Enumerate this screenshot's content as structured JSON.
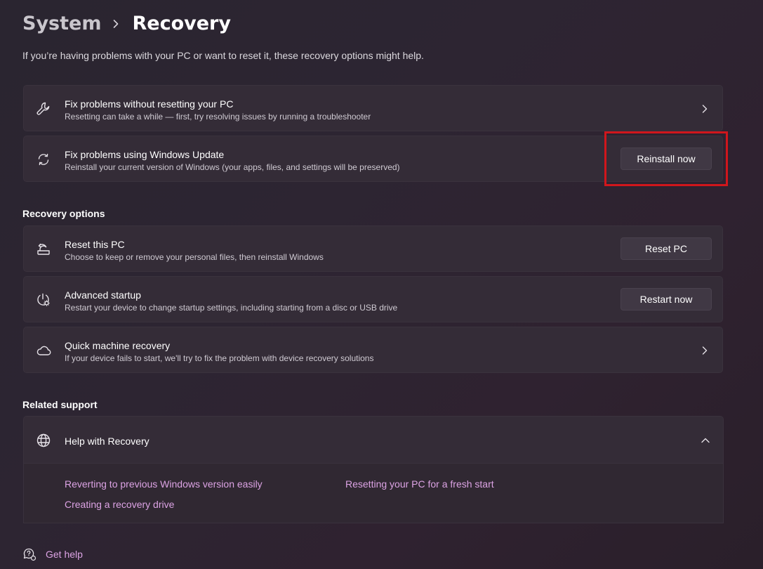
{
  "breadcrumb": {
    "parent": "System",
    "current": "Recovery"
  },
  "intro": "If you’re having problems with your PC or want to reset it, these recovery options might help.",
  "fix_cards": [
    {
      "title": "Fix problems without resetting your PC",
      "desc": "Resetting can take a while — first, try resolving issues by running a troubleshooter",
      "icon": "wrench-icon"
    },
    {
      "title": "Fix problems using Windows Update",
      "desc": "Reinstall your current version of Windows (your apps, files, and settings will be preserved)",
      "icon": "sync-icon",
      "button": "Reinstall now"
    }
  ],
  "recovery_options": {
    "heading": "Recovery options",
    "items": [
      {
        "title": "Reset this PC",
        "desc": "Choose to keep or remove your personal files, then reinstall Windows",
        "icon": "reset-pc-icon",
        "button": "Reset PC"
      },
      {
        "title": "Advanced startup",
        "desc": "Restart your device to change startup settings, including starting from a disc or USB drive",
        "icon": "advanced-startup-icon",
        "button": "Restart now"
      },
      {
        "title": "Quick machine recovery",
        "desc": "If your device fails to start, we'll try to fix the problem with device recovery solutions",
        "icon": "cloud-icon"
      }
    ]
  },
  "related_support": {
    "heading": "Related support",
    "expander_title": "Help with Recovery",
    "links": [
      "Reverting to previous Windows version easily",
      "Resetting your PC for a fresh start",
      "Creating a recovery drive"
    ]
  },
  "get_help": "Get help",
  "colors": {
    "link": "#dca3e4",
    "card": "#342c37",
    "highlight": "#d0161c"
  }
}
